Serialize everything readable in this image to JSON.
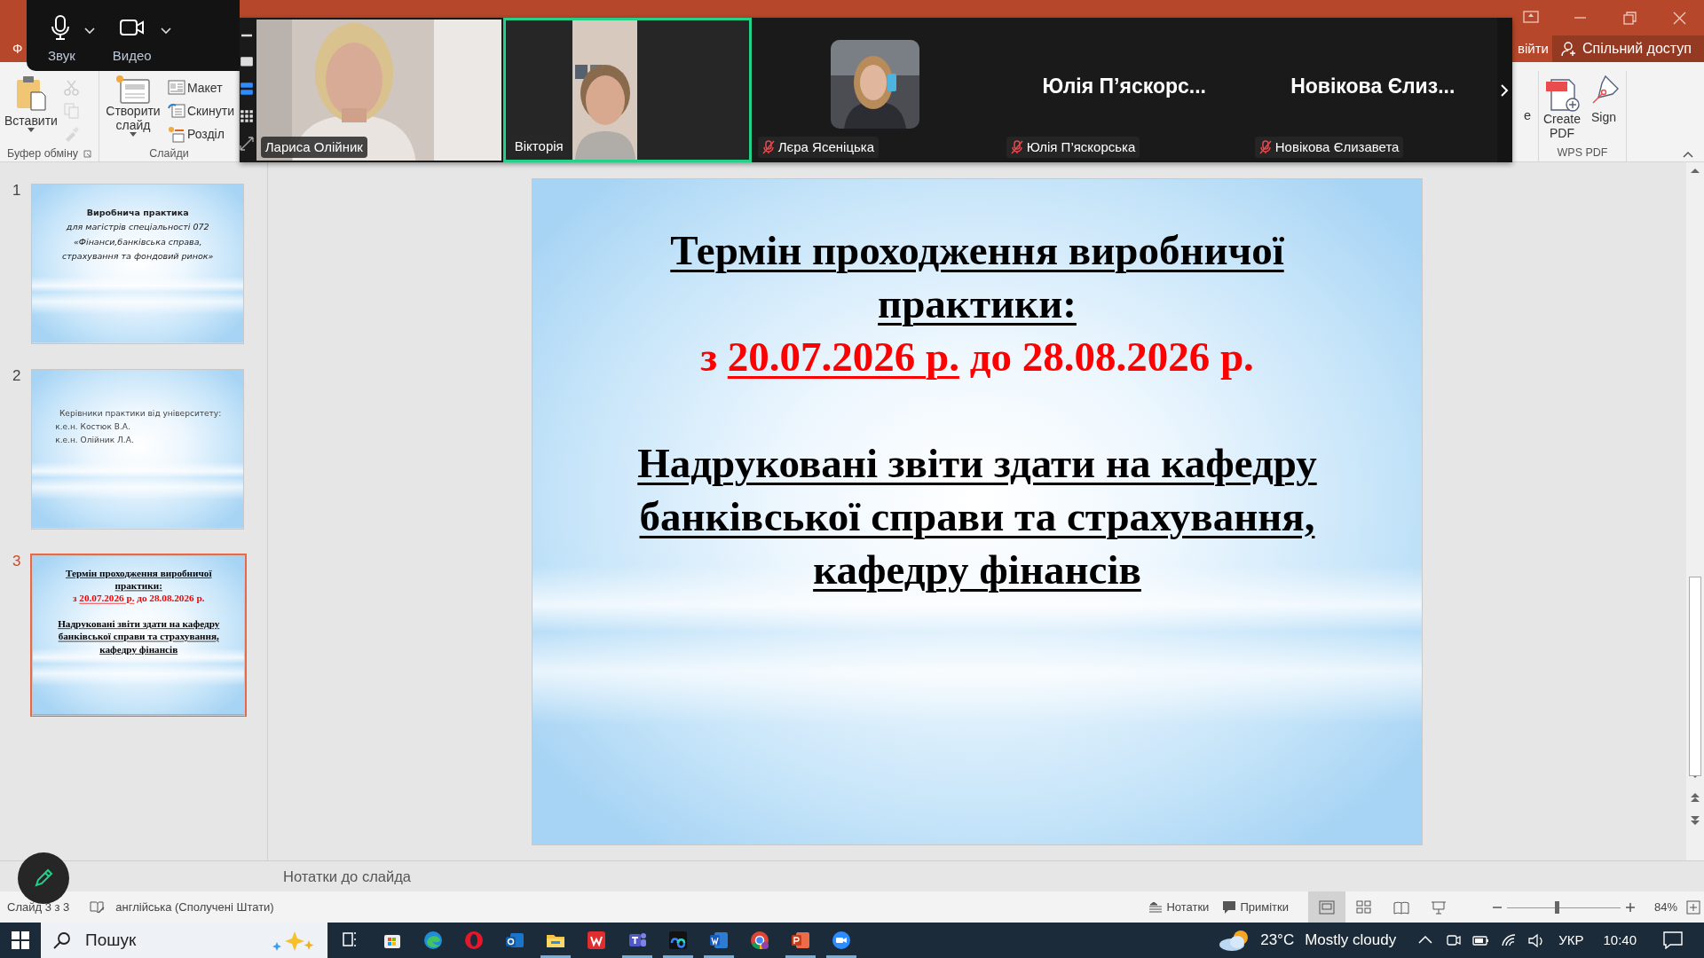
{
  "title_bar": {
    "file_tab_partial": "Ф",
    "signin_partial": "війти",
    "share_button": "Спільний доступ"
  },
  "ribbon": {
    "groups": [
      {
        "label": "Буфер обміну",
        "launcher": true,
        "items": [
          {
            "kind": "paste",
            "label": "Вставити",
            "disabled": false
          },
          {
            "kind": "cut",
            "disabled": true
          },
          {
            "kind": "copy",
            "disabled": true
          },
          {
            "kind": "painter",
            "disabled": true
          }
        ]
      },
      {
        "label": "Слайди",
        "items": [
          {
            "kind": "new-slide",
            "label": "Створити слайд",
            "disabled": false
          },
          {
            "kind": "layout",
            "label": "Макет",
            "disabled": false
          },
          {
            "kind": "reset",
            "label": "Скинути",
            "disabled": false
          },
          {
            "kind": "section",
            "label": "Розділ",
            "disabled": false
          }
        ]
      }
    ],
    "partial_label": "e",
    "right_groups": [
      {
        "label": "WPS PDF",
        "items": [
          {
            "kind": "create-pdf",
            "label": "Create PDF",
            "disabled": false
          },
          {
            "kind": "sign",
            "label": "Sign",
            "disabled": false
          }
        ]
      }
    ]
  },
  "zoom_toolbar": {
    "buttons": [
      {
        "kind": "mic",
        "label": "Звук"
      },
      {
        "kind": "camera",
        "label": "Видео"
      }
    ]
  },
  "video_strip": {
    "layout_options": [
      {
        "kind": "single",
        "selected": false
      },
      {
        "kind": "strip",
        "selected": true
      },
      {
        "kind": "grid",
        "selected": false
      }
    ],
    "tiles": [
      {
        "kind": "video",
        "name": "Лариса Олійник",
        "muted": false,
        "selected": false
      },
      {
        "kind": "video-portrait",
        "name": "Вікторія",
        "muted": false,
        "selected": true
      },
      {
        "kind": "avatar",
        "name": "Лєра Ясеніцька",
        "muted": true,
        "selected": false
      },
      {
        "kind": "name",
        "display_name": "Юлія П’яскорс...",
        "name": "Юлія П’яскорська",
        "muted": true,
        "selected": false
      },
      {
        "kind": "name",
        "display_name": "Новікова Єлиз...",
        "name": "Новікова Єлизавета",
        "muted": true,
        "selected": false
      }
    ]
  },
  "thumbnails": [
    {
      "number": "1",
      "selected": false,
      "kind": "title",
      "blocks": [
        [
          {
            "kind": "title",
            "text": "Виробнича практика"
          },
          {
            "kind": "subtitle",
            "text": "для магістрів спеціальності 072"
          },
          {
            "kind": "subtitle",
            "text": "«Фінанси,банківська справа,"
          },
          {
            "kind": "subtitle",
            "text": "страхування та фондовий ринок»"
          }
        ]
      ]
    },
    {
      "number": "2",
      "selected": false,
      "kind": "list",
      "blocks": [
        [
          {
            "kind": "lead",
            "text": "Керівники практики від університету:"
          },
          {
            "kind": "body",
            "text": "к.е.н. Костюк В.А."
          },
          {
            "kind": "body",
            "text": "к.е.н. Олійник Л.А."
          }
        ]
      ]
    },
    {
      "number": "3",
      "selected": true,
      "kind": "headline",
      "blocks": [
        [
          {
            "kind": "headline",
            "color": "#000000",
            "segments": [
              {
                "text": "Термін проходження виробничої практики:",
                "underline": true
              }
            ]
          },
          {
            "kind": "headline",
            "color": "#ff0000",
            "segments": [
              {
                "text": "з ",
                "underline": false
              },
              {
                "text": "20.07.2026 р.",
                "underline": true
              },
              {
                "text": " до 28.08.2026 р.",
                "underline": false
              }
            ]
          }
        ],
        [
          {
            "kind": "headline",
            "color": "#000000",
            "segments": [
              {
                "text": "Надруковані звіти здати на кафедру банківської справи та страхування, кафедру фінансів",
                "underline": true
              }
            ]
          }
        ]
      ]
    }
  ],
  "slide": {
    "kind": "headline",
    "blocks": [
      [
        {
          "kind": "headline",
          "color": "#000000",
          "segments": [
            {
              "text": "Термін проходження виробничої практики:",
              "underline": true
            }
          ]
        },
        {
          "kind": "headline",
          "color": "#ff0000",
          "segments": [
            {
              "text": "з ",
              "underline": false
            },
            {
              "text": "20.07.2026 р.",
              "underline": true
            },
            {
              "text": " до 28.08.2026 р.",
              "underline": false
            }
          ]
        }
      ],
      [
        {
          "kind": "headline",
          "color": "#000000",
          "segments": [
            {
              "text": "Надруковані звіти здати на кафедру банківської справи та страхування, кафедру фінансів",
              "underline": true
            }
          ]
        }
      ]
    ]
  },
  "notes": {
    "placeholder": "Нотатки до слайда"
  },
  "status_bar": {
    "slide_counter": "Слайд 3 з 3",
    "language": "англійська (Сполучені Штати)",
    "notes_button": "Нотатки",
    "comments_button": "Примітки",
    "views": [
      {
        "kind": "normal",
        "selected": true
      },
      {
        "kind": "sorter",
        "selected": false
      },
      {
        "kind": "reading",
        "selected": false
      },
      {
        "kind": "show",
        "selected": false
      }
    ],
    "zoom": {
      "level": 0.44,
      "reading": "84%"
    }
  },
  "taskbar": {
    "search": {
      "placeholder": "Пошук"
    },
    "apps": [
      {
        "kind": "taskview",
        "running": false
      },
      {
        "kind": "store",
        "running": false
      },
      {
        "kind": "edge",
        "running": false
      },
      {
        "kind": "opera",
        "running": false
      },
      {
        "kind": "outlook",
        "running": false
      },
      {
        "kind": "explorer",
        "running": true
      },
      {
        "kind": "wps",
        "running": false
      },
      {
        "kind": "teams",
        "running": true
      },
      {
        "kind": "loop",
        "running": true
      },
      {
        "kind": "word",
        "running": true
      },
      {
        "kind": "chrome",
        "running": false
      },
      {
        "kind": "powerpoint",
        "running": true
      },
      {
        "kind": "zoom",
        "running": true
      }
    ],
    "weather": {
      "temperature": "23°C",
      "condition": "Mostly cloudy"
    },
    "language": "УКР",
    "time": "10:40"
  }
}
